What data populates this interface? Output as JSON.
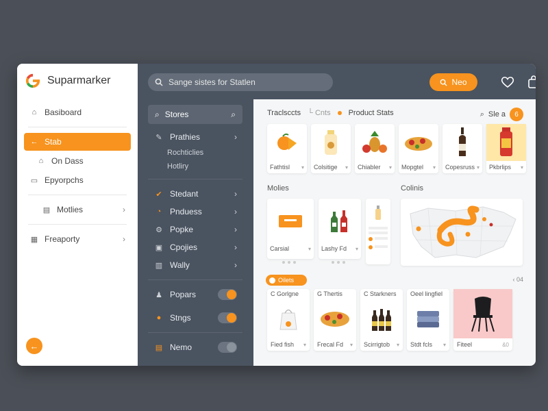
{
  "brand": {
    "name": "Suparmarker"
  },
  "left_nav": {
    "items": [
      {
        "label": "Basiboard",
        "icon": "home-icon"
      },
      {
        "label": "Stab",
        "icon": "arrow-left-icon",
        "active": true
      },
      {
        "label": "On Dass",
        "icon": "home-icon"
      },
      {
        "label": "Epyorpchs",
        "icon": "monitor-icon"
      },
      {
        "label": "Motlies",
        "icon": "grid-icon"
      },
      {
        "label": "Freaporty",
        "icon": "calendar-icon"
      }
    ]
  },
  "topbar": {
    "search_text": "Sange sistes for Statlen",
    "new_label": "Neo"
  },
  "middle_menu": {
    "header": "Stores",
    "items": [
      {
        "label": "Prathies",
        "icon": "pencil-icon"
      },
      {
        "label": "Rochticlies",
        "sub": true
      },
      {
        "label": "Hotliry",
        "sub": true
      },
      {
        "label": "Stedant",
        "icon": "check-icon"
      },
      {
        "label": "Pnduess",
        "icon": "clock-icon"
      },
      {
        "label": "Popke",
        "icon": "gear-icon"
      },
      {
        "label": "Cpojies",
        "icon": "box-icon"
      },
      {
        "label": "Wally",
        "icon": "chart-icon"
      },
      {
        "label": "Popars",
        "icon": "people-icon"
      },
      {
        "label": "Stngs",
        "icon": "settings-icon"
      },
      {
        "label": "Nemo",
        "icon": "folder-icon"
      }
    ]
  },
  "content": {
    "tabs": [
      "Traclsccts",
      "Cnts"
    ],
    "product_label": "Product Stats",
    "right_label": "Sle a",
    "badge": "6",
    "products": [
      {
        "label": "Fathtisl"
      },
      {
        "label": "Colsitige"
      },
      {
        "label": "Chiabler"
      },
      {
        "label": "Mopgtel"
      },
      {
        "label": "Copesruss"
      },
      {
        "label": "Pkbrlips"
      }
    ],
    "middle_title": "Molies",
    "map_title": "Colinis",
    "mid_cards": [
      {
        "label": "Carsial"
      },
      {
        "label": "Lashy Fd"
      }
    ],
    "filter_label": "Oilets",
    "pager": "‹ 04",
    "bottom_cards": [
      {
        "top": "C Gorlgne",
        "label": "Fied fish"
      },
      {
        "top": "G Thertis",
        "label": "Frecal Fd"
      },
      {
        "top": "C Starkners",
        "label": "Scirrigtob"
      },
      {
        "top": "Oeel lingfiel",
        "label": "Stdt fcls"
      },
      {
        "top": "",
        "label": "Fiteel",
        "extra": "&0"
      }
    ]
  },
  "colors": {
    "accent": "#f7931e",
    "dark_panel": "#4a5360",
    "background": "#4b4f57"
  }
}
